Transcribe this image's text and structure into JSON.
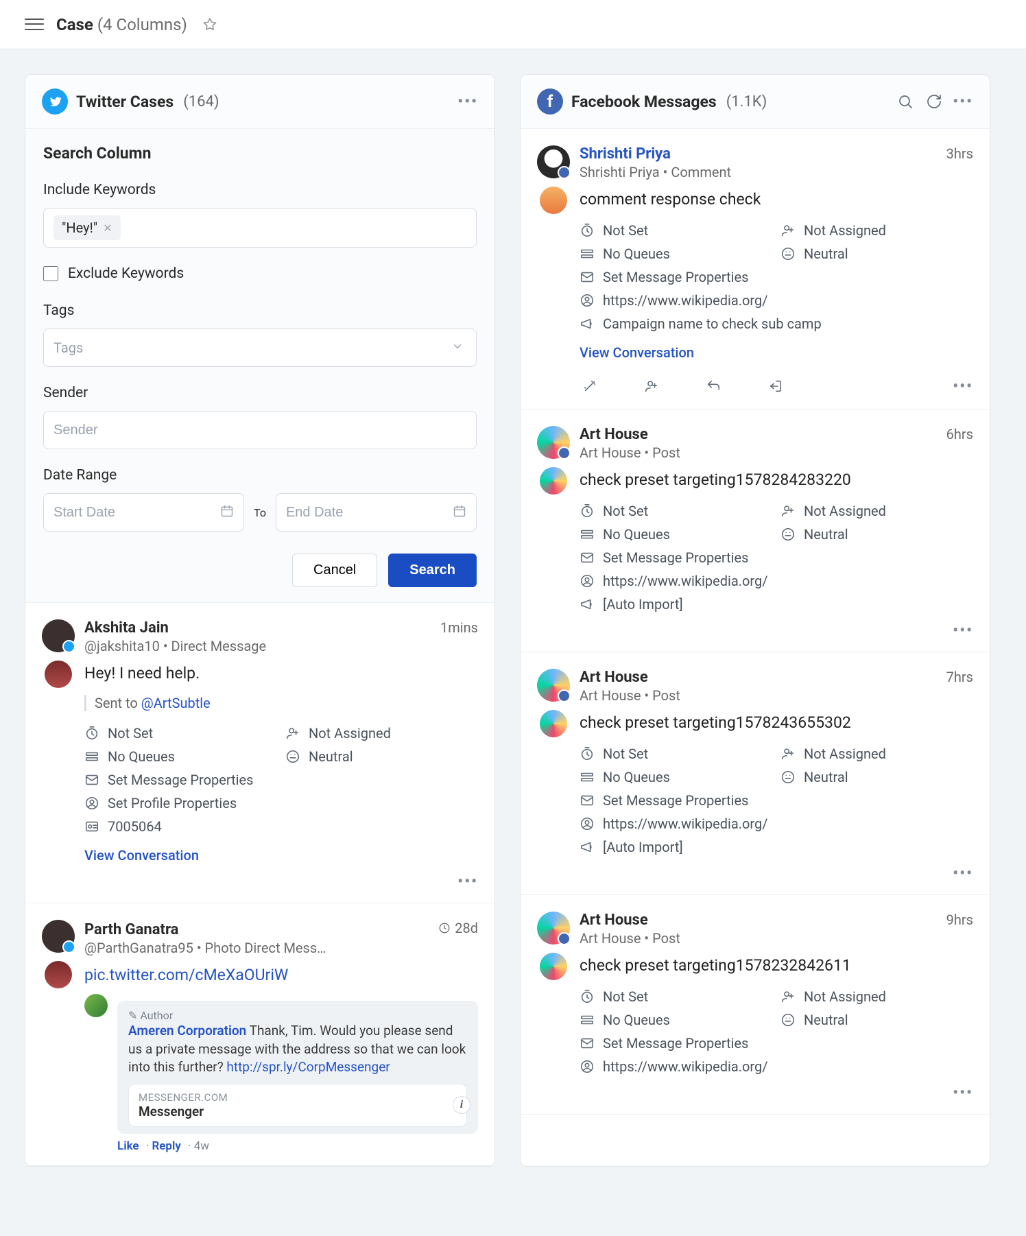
{
  "header": {
    "title": "Case",
    "subtitle": "(4 Columns)"
  },
  "col1": {
    "title": "Twitter Cases",
    "count": "(164)",
    "searchTitle": "Search Column",
    "includeLabel": "Include Keywords",
    "chip": "\"Hey!\"",
    "excludeLabel": "Exclude Keywords",
    "tagsLabel": "Tags",
    "tagsPlaceholder": "Tags",
    "senderLabel": "Sender",
    "senderPlaceholder": "Sender",
    "dateRangeLabel": "Date Range",
    "startPlaceholder": "Start Date",
    "to": "To",
    "endPlaceholder": "End Date",
    "cancel": "Cancel",
    "search": "Search",
    "msgs": [
      {
        "author": "Akshita Jain",
        "sub": "@jakshita10 • Direct Message",
        "time": "1mins",
        "body": "Hey! I need help.",
        "sentTo": "Sent to ",
        "sentToHandle": "@ArtSubtle",
        "meta": {
          "status": "Not Set",
          "assigned": "Not Assigned",
          "queue": "No Queues",
          "sentiment": "Neutral",
          "r1": "Set Message Properties",
          "r2": "Set Profile Properties",
          "r3": "7005064"
        },
        "view": "View Conversation"
      },
      {
        "author": "Parth Ganatra",
        "sub": "@ParthGanatra95 • Photo Direct Mess…",
        "time": "28d",
        "link": "pic.twitter.com/cMeXaOUriW",
        "embed": {
          "badge": "✎ Author",
          "corp": "Ameren Corporation",
          "text": " Thank, Tim. Would you please send us a private message with the address so that we can look into this further? ",
          "url": "http://spr.ly/CorpMessenger",
          "domain": "MESSENGER.COM",
          "label": "Messenger",
          "like": "Like",
          "reply": "Reply",
          "ago": "4w"
        }
      }
    ]
  },
  "col2": {
    "title": "Facebook Messages",
    "count": "(1.1K)",
    "msgs": [
      {
        "author": "Shrishti Priya",
        "sub": "Shrishti Priya • Comment",
        "time": "3hrs",
        "body": "comment response check",
        "link": true,
        "meta": {
          "status": "Not Set",
          "assigned": "Not Assigned",
          "queue": "No Queues",
          "sentiment": "Neutral",
          "r1": "Set Message Properties",
          "r2": "https://www.wikipedia.org/",
          "r3": "Campaign name to check sub camp"
        },
        "view": "View Conversation",
        "actions": true
      },
      {
        "author": "Art House",
        "sub": "Art House • Post",
        "time": "6hrs",
        "body": "check preset targeting1578284283220",
        "meta": {
          "status": "Not Set",
          "assigned": "Not Assigned",
          "queue": "No Queues",
          "sentiment": "Neutral",
          "r1": "Set Message Properties",
          "r2": "https://www.wikipedia.org/",
          "r3": "[Auto Import]"
        }
      },
      {
        "author": "Art House",
        "sub": "Art House • Post",
        "time": "7hrs",
        "body": "check preset targeting1578243655302",
        "meta": {
          "status": "Not Set",
          "assigned": "Not Assigned",
          "queue": "No Queues",
          "sentiment": "Neutral",
          "r1": "Set Message Properties",
          "r2": "https://www.wikipedia.org/",
          "r3": "[Auto Import]"
        }
      },
      {
        "author": "Art House",
        "sub": "Art House • Post",
        "time": "9hrs",
        "body": "check preset targeting1578232842611",
        "meta": {
          "status": "Not Set",
          "assigned": "Not Assigned",
          "queue": "No Queues",
          "sentiment": "Neutral",
          "r1": "Set Message Properties",
          "r2": "https://www.wikipedia.org/"
        }
      }
    ]
  }
}
